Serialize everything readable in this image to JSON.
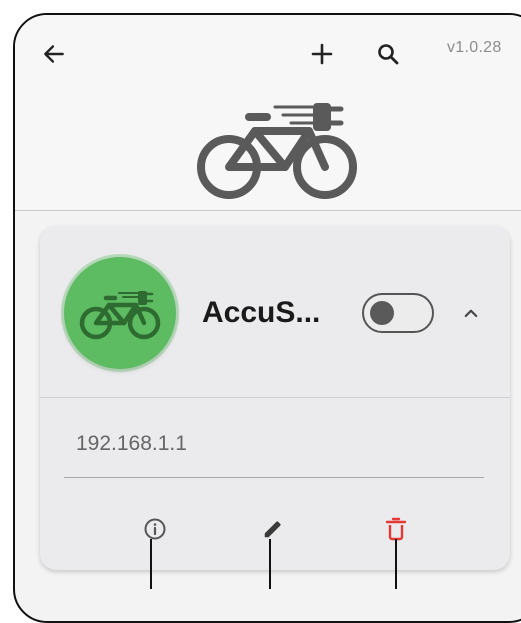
{
  "app": {
    "version": "v1.0.28",
    "icons": {
      "back": "arrow-left-icon",
      "add": "plus-icon",
      "search": "search-icon",
      "hero": "ebike-plug-icon"
    }
  },
  "device": {
    "name": "AccuS...",
    "ip": "192.168.1.1",
    "enabled": false,
    "expanded": true,
    "avatar_color": "#5dbb62",
    "actions": [
      {
        "name": "info",
        "icon": "info-icon",
        "color": "#555555"
      },
      {
        "name": "edit",
        "icon": "pencil-icon",
        "color": "#3a3a3a"
      },
      {
        "name": "delete",
        "icon": "trash-icon",
        "color": "#e53935"
      }
    ]
  }
}
